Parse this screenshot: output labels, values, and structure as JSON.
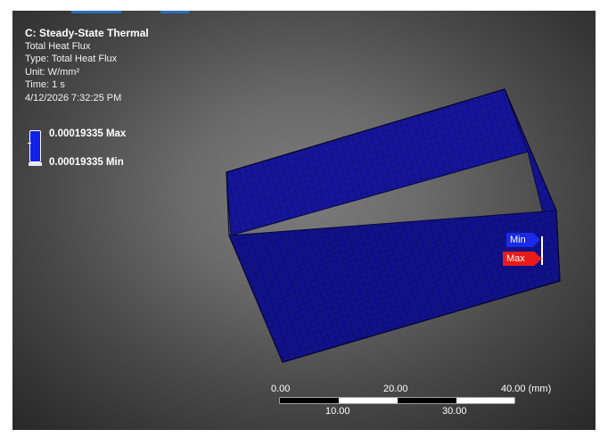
{
  "info": {
    "title": "C: Steady-State Thermal",
    "result": "Total Heat Flux",
    "type": "Type: Total Heat Flux",
    "unit": "Unit: W/mm²",
    "time": "Time: 1 s",
    "timestamp": "4/12/2026 7:32:25 PM"
  },
  "legend": {
    "max_label": "0.00019335 Max",
    "min_label": "0.00019335 Min",
    "color": "#1020e8"
  },
  "probes": {
    "min_label": "Min",
    "max_label": "Max",
    "min_color": "#1a2ae8",
    "max_color": "#e81a1a"
  },
  "scale_bar": {
    "top_ticks": [
      "0.00",
      "20.00",
      "40.00 (mm)"
    ],
    "bottom_ticks": [
      "10.00",
      "30.00"
    ]
  },
  "colors": {
    "mesh_face": "#14149a",
    "mesh_line": "#0a0a55",
    "accent": "#2b6fb6"
  }
}
